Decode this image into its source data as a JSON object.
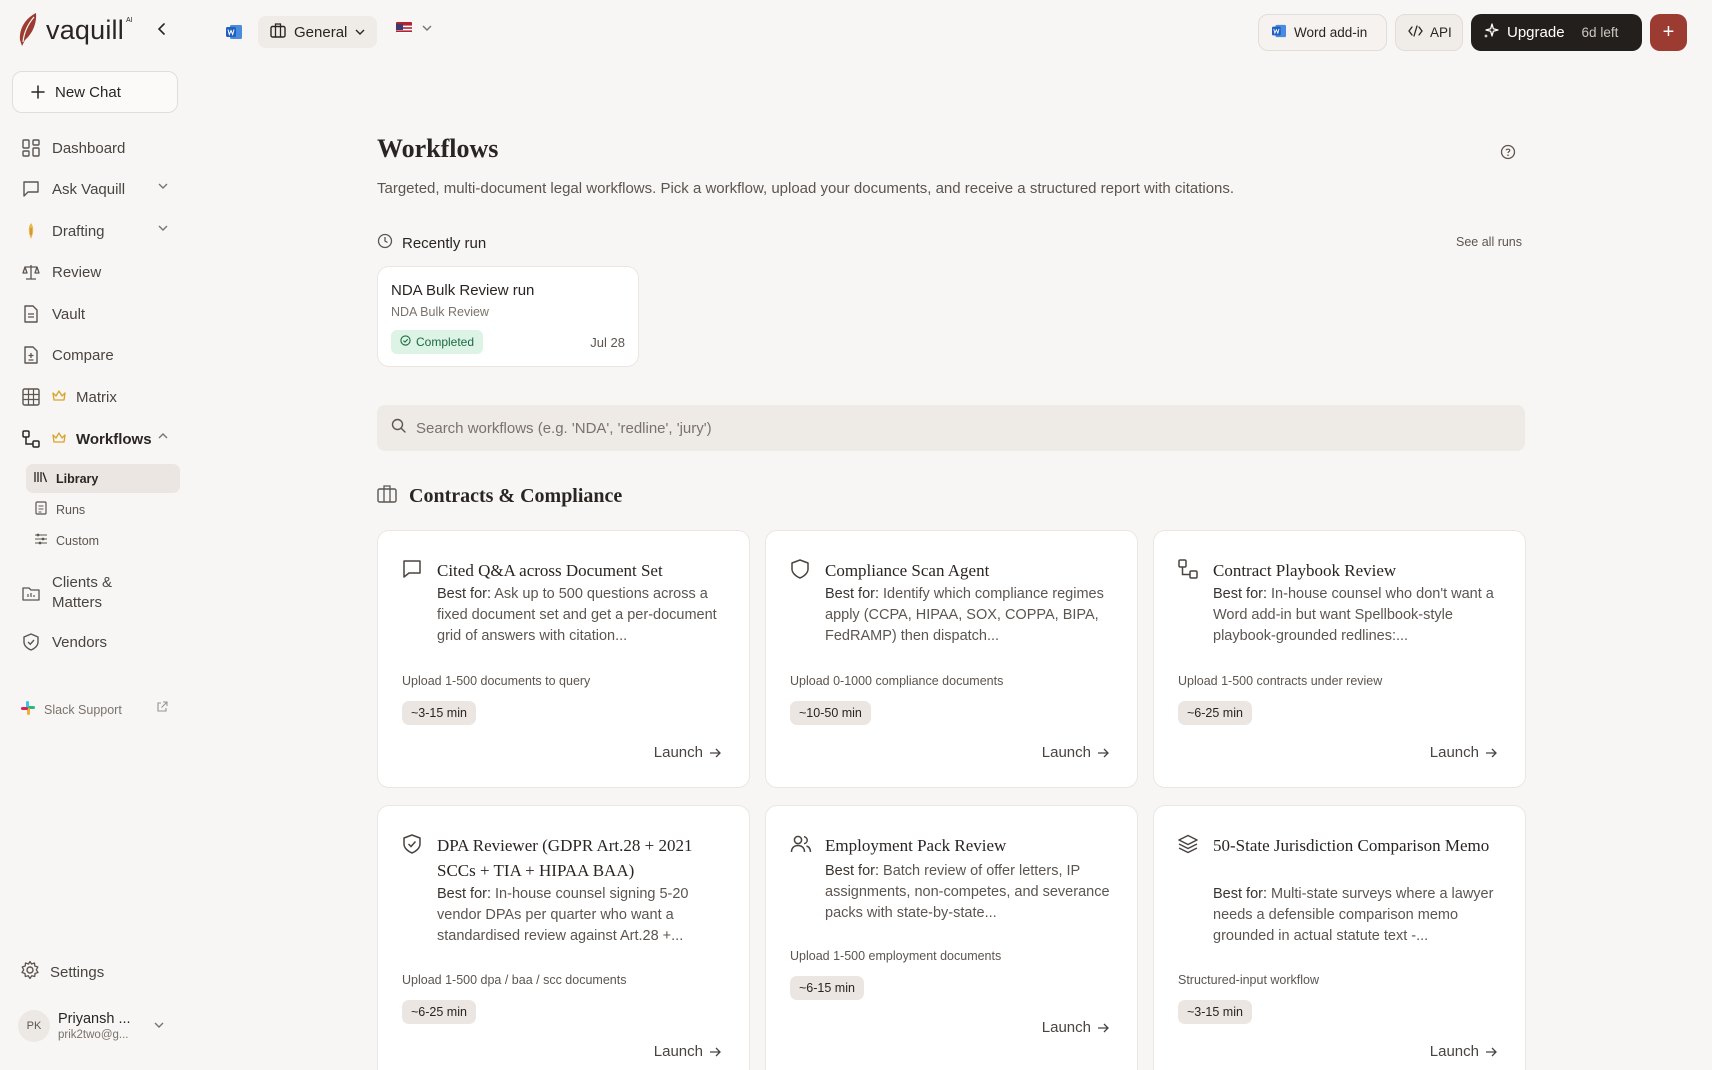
{
  "brand": {
    "name": "vaquill",
    "sup": "AI"
  },
  "sidebar": {
    "new_chat": "New Chat",
    "items": [
      {
        "label": "Dashboard"
      },
      {
        "label": "Ask Vaquill"
      },
      {
        "label": "Drafting"
      },
      {
        "label": "Review"
      },
      {
        "label": "Vault"
      },
      {
        "label": "Compare"
      },
      {
        "label": "Matrix"
      },
      {
        "label": "Workflows"
      },
      {
        "label": "Clients & Matters"
      },
      {
        "label": "Vendors"
      }
    ],
    "sub_items": [
      {
        "label": "Library"
      },
      {
        "label": "Runs"
      },
      {
        "label": "Custom"
      }
    ],
    "slack": "Slack Support",
    "settings": "Settings",
    "user": {
      "initials": "PK",
      "name": "Priyansh ...",
      "email": "prik2two@g..."
    }
  },
  "topbar": {
    "workspace": "General",
    "word_addin": "Word add-in",
    "api": "API",
    "upgrade": "Upgrade",
    "days_left": "6d left",
    "plus": "+"
  },
  "main": {
    "title": "Workflows",
    "description": "Targeted, multi-document legal workflows. Pick a workflow, upload your documents, and receive a structured report with citations.",
    "recent_label": "Recently run",
    "see_all": "See all runs",
    "recent_run": {
      "title": "NDA Bulk Review run",
      "subtitle": "NDA Bulk Review",
      "status": "Completed",
      "date": "Jul 28"
    },
    "search_placeholder": "Search workflows (e.g. 'NDA', 'redline', 'jury')",
    "section_title": "Contracts & Compliance",
    "best_for_label": "Best for:",
    "launch_label": "Launch",
    "cards": [
      {
        "icon": "chat-bubble-icon",
        "title": "Cited Q&A across Document Set",
        "desc": "Ask up to 500 questions across a fixed document set and get a per-document grid of answers with citation...",
        "upload": "Upload 1-500 documents to query",
        "time": "~3-15 min"
      },
      {
        "icon": "shield-icon",
        "title": "Compliance Scan Agent",
        "desc": "Identify which compliance regimes apply (CCPA, HIPAA, SOX, COPPA, BIPA, FedRAMP) then dispatch...",
        "upload": "Upload 0-1000 compliance documents",
        "time": "~10-50 min"
      },
      {
        "icon": "workflow-icon",
        "title": "Contract Playbook Review",
        "desc": "In-house counsel who don't want a Word add-in but want Spellbook-style playbook-grounded redlines:...",
        "upload": "Upload 1-500 contracts under review",
        "time": "~6-25 min"
      },
      {
        "icon": "shield-check-icon",
        "title": "DPA Reviewer (GDPR Art.28 + 2021 SCCs + TIA + HIPAA BAA)",
        "desc": "In-house counsel signing 5-20 vendor DPAs per quarter who want a standardised review against Art.28 +...",
        "upload": "Upload 1-500 dpa / baa / scc documents",
        "time": "~6-25 min"
      },
      {
        "icon": "users-icon",
        "title": "Employment Pack Review",
        "desc": "Batch review of offer letters, IP assignments, non-competes, and severance packs with state-by-state...",
        "upload": "Upload 1-500 employment documents",
        "time": "~6-15 min"
      },
      {
        "icon": "layers-icon",
        "title": "50-State Jurisdiction Comparison Memo",
        "desc": "Multi-state surveys where a lawyer needs a defensible comparison memo grounded in actual statute text -...",
        "upload": "Structured-input workflow",
        "time": "~3-15 min"
      }
    ]
  }
}
